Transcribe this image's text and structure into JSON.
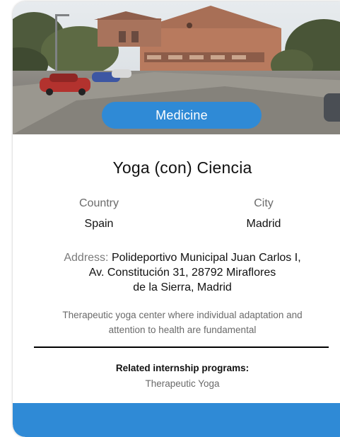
{
  "card": {
    "category_badge": "Medicine",
    "title": "Yoga (con) Ciencia",
    "country_label": "Country",
    "country_value": "Spain",
    "city_label": "City",
    "city_value": "Madrid",
    "address_label": "Address:",
    "address_line1": "Polideportivo Municipal Juan Carlos I,",
    "address_line2": "Av. Constitución 31, 28792 Miraflores",
    "address_line3": "de la Sierra, Madrid",
    "description_line1": "Therapeutic yoga center where individual adaptation and",
    "description_line2": "attention to health are fundamental",
    "related_title": "Related internship programs:",
    "related_programs": [
      "Therapeutic Yoga"
    ]
  },
  "colors": {
    "accent_blue": "#2f8ad6",
    "footer_blue": "#2f8ad6"
  }
}
